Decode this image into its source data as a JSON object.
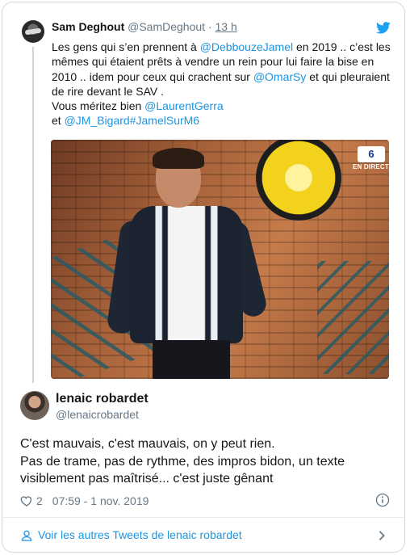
{
  "parent_tweet": {
    "author_name": "Sam Deghout",
    "author_handle": "@SamDeghout",
    "separator": "·",
    "time": "13 h",
    "text_parts": {
      "t1": "Les gens qui s’en prennent à ",
      "m1": "@DebbouzeJamel",
      "t2": " en 2019 .. c’est les mêmes qui étaient prêts à vendre un rein pour lui faire la bise en 2010 .. idem pour ceux qui crachent sur ",
      "m2": "@OmarSy",
      "t3": " et qui pleuraient de rire devant le SAV .",
      "t4": "Vous méritez bien ",
      "m3": "@LaurentGerra",
      "t5": "et ",
      "m4": "@JM_Bigard",
      "m5": "#JamelSurM6"
    },
    "media": {
      "channel_logo": "6",
      "live_label": "EN DIRECT"
    }
  },
  "tweet": {
    "author_name": "lenaic robardet",
    "author_handle": "@lenaicrobardet",
    "line1": "C'est mauvais, c'est mauvais, on y peut rien.",
    "line2": "Pas de trame, pas de rythme, des impros bidon, un texte visiblement pas maîtrisé... c'est juste gênant",
    "like_count": "2",
    "timestamp": "07:59 - 1 nov. 2019"
  },
  "footer": {
    "link_label": "Voir les autres Tweets de lenaic robardet"
  },
  "icons": {
    "bird": "twitter-bird-icon",
    "heart": "heart-icon",
    "info": "info-icon",
    "person": "person-icon",
    "chevron": "chevron-right-icon"
  },
  "colors": {
    "accent": "#1b95e0",
    "text": "#14171a",
    "secondary": "#657786",
    "border": "#cfd9de"
  }
}
